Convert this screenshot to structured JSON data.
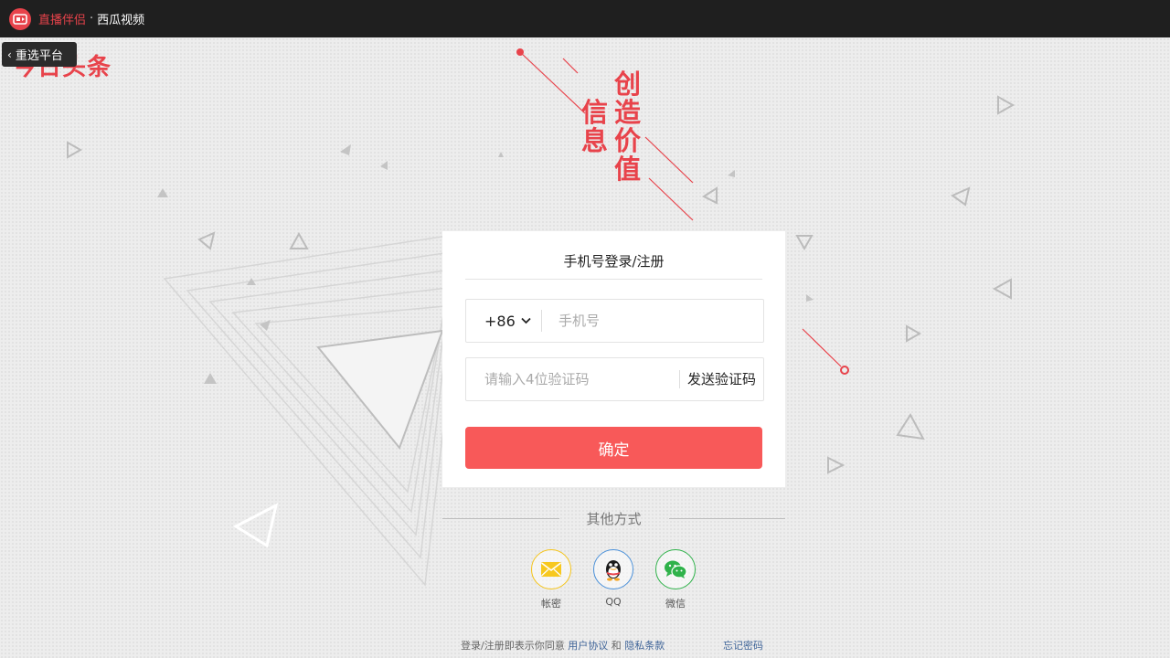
{
  "window": {
    "app_name": "直播伴侣",
    "separator": "·",
    "platform_name": "西瓜视频"
  },
  "brand": {
    "logo_text": "今日头条",
    "slogan_col1": "信息",
    "slogan_col2": "创造价值",
    "accent_color": "#e8434b"
  },
  "back_button": {
    "label": "重选平台",
    "icon": "chevron-left-icon"
  },
  "login": {
    "title": "手机号登录/注册",
    "country_code": "+86",
    "phone_placeholder": "手机号",
    "code_placeholder": "请输入4位验证码",
    "send_code_label": "发送验证码",
    "submit_label": "确定",
    "submit_color": "#f85959"
  },
  "other_methods": {
    "title": "其他方式",
    "items": [
      {
        "label": "帐密",
        "icon": "envelope-icon"
      },
      {
        "label": "QQ",
        "icon": "qq-penguin-icon"
      },
      {
        "label": "微信",
        "icon": "wechat-icon"
      }
    ]
  },
  "footer": {
    "prefix": "登录/注册即表示你同意",
    "agreement": "用户协议",
    "and": "和",
    "privacy": "隐私条款",
    "forgot_password": "忘记密码"
  }
}
